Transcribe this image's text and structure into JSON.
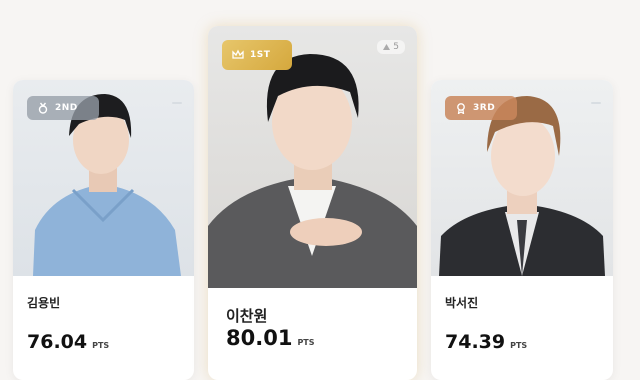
{
  "ranking": {
    "cards": [
      {
        "rank_label": "1ST",
        "name": "이찬원",
        "score": "80.01",
        "unit": "PTS",
        "change": "5",
        "badge_color": "#d9ad45"
      },
      {
        "rank_label": "2ND",
        "name": "김용빈",
        "score": "76.04",
        "unit": "PTS",
        "badge_color": "#959ea8"
      },
      {
        "rank_label": "3RD",
        "name": "박서진",
        "score": "74.39",
        "unit": "PTS",
        "badge_color": "#c9865c"
      }
    ]
  }
}
